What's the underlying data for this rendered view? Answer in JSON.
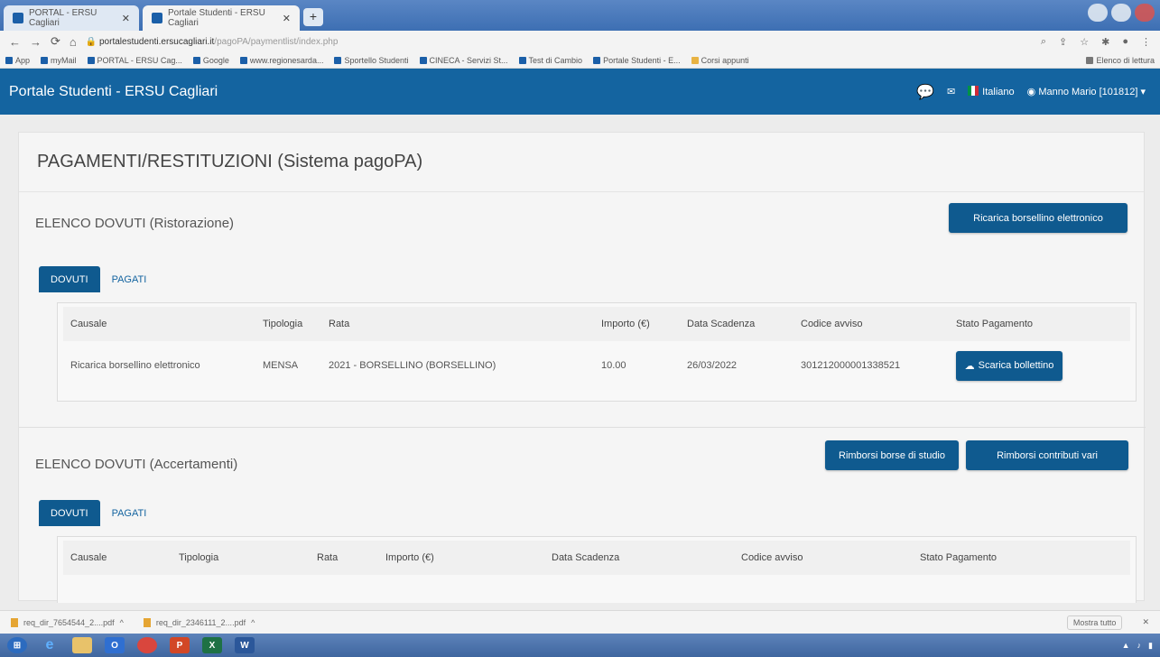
{
  "browser": {
    "tabs": [
      {
        "title": "PORTAL - ERSU Cagliari"
      },
      {
        "title": "Portale Studenti - ERSU Cagliari"
      }
    ],
    "new_tab": "+",
    "url_main": "portalestudenti.ersucagliari.it",
    "url_path": "/pagoPA/paymentlist/index.php",
    "bookmarks": [
      "App",
      "myMail",
      "PORTAL - ERSU Cag...",
      "Google",
      "www.regionesarda...",
      "Sportello Studenti",
      "CINECA - Servizi St...",
      "Test di Cambio",
      "Portale Studenti - E...",
      "Corsi appunti"
    ],
    "bookmarks_right": "Elenco di lettura",
    "downloads": [
      "req_dir_7654544_2....pdf",
      "req_dir_2346111_2....pdf"
    ],
    "show_all": "Mostra tutto"
  },
  "navbar": {
    "brand": "Portale Studenti - ERSU Cagliari",
    "language": "Italiano",
    "user": "Manno Mario [101812]"
  },
  "page": {
    "title": "PAGAMENTI/RESTITUZIONI (Sistema pagoPA)"
  },
  "section1": {
    "title": "ELENCO DOVUTI (Ristorazione)",
    "button": "Ricarica borsellino elettronico",
    "tabs": [
      "DOVUTI",
      "PAGATI"
    ],
    "columns": [
      "Causale",
      "Tipologia",
      "Rata",
      "Importo (€)",
      "Data Scadenza",
      "Codice avviso",
      "Stato Pagamento"
    ],
    "rows": [
      {
        "causale": "Ricarica borsellino elettronico",
        "tipologia": "MENSA",
        "rata": "2021 - BORSELLINO (BORSELLINO)",
        "importo": "10.00",
        "scadenza": "26/03/2022",
        "codice": "301212000001338521",
        "action": "Scarica bollettino"
      }
    ]
  },
  "section2": {
    "title": "ELENCO DOVUTI (Accertamenti)",
    "button1": "Rimborsi borse di studio",
    "button2": "Rimborsi contributi vari",
    "tabs": [
      "DOVUTI",
      "PAGATI"
    ],
    "columns": [
      "Causale",
      "Tipologia",
      "Rata",
      "Importo (€)",
      "Data Scadenza",
      "Codice avviso",
      "Stato Pagamento"
    ]
  },
  "colors": {
    "navbar": "#1464a0",
    "button": "#0f5a8f"
  }
}
